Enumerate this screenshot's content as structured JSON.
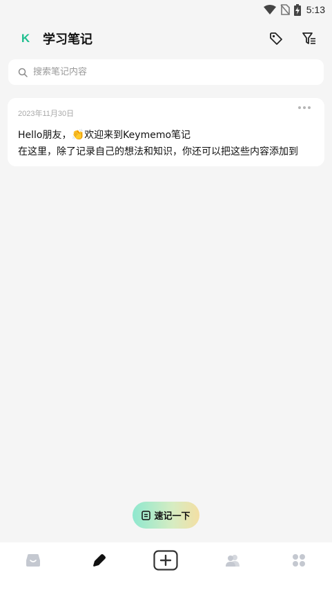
{
  "status_bar": {
    "time": "5:13",
    "icons": [
      "wifi-icon",
      "no-sim-icon",
      "battery-charging-icon"
    ]
  },
  "header": {
    "logo": "K",
    "title": "学习笔记",
    "actions": [
      "tag-icon",
      "filter-icon"
    ]
  },
  "search": {
    "placeholder": "搜索笔记内容",
    "value": ""
  },
  "notes": [
    {
      "date": "2023年11月30日",
      "line1_prefix": "Hello朋友，",
      "emoji": "👏",
      "line1_suffix": "欢迎来到Keymemo笔记",
      "line2": "在这里，除了记录自己的想法和知识，你还可以把这些内容添加到"
    }
  ],
  "quick_note": {
    "label": "速记一下"
  },
  "bottom_nav": {
    "items": [
      "inbox-icon",
      "note-icon",
      "add-icon",
      "contacts-icon",
      "apps-icon"
    ],
    "active": "note-icon"
  },
  "colors": {
    "accent": "#1fbf8f",
    "background": "#f5f5f5"
  }
}
